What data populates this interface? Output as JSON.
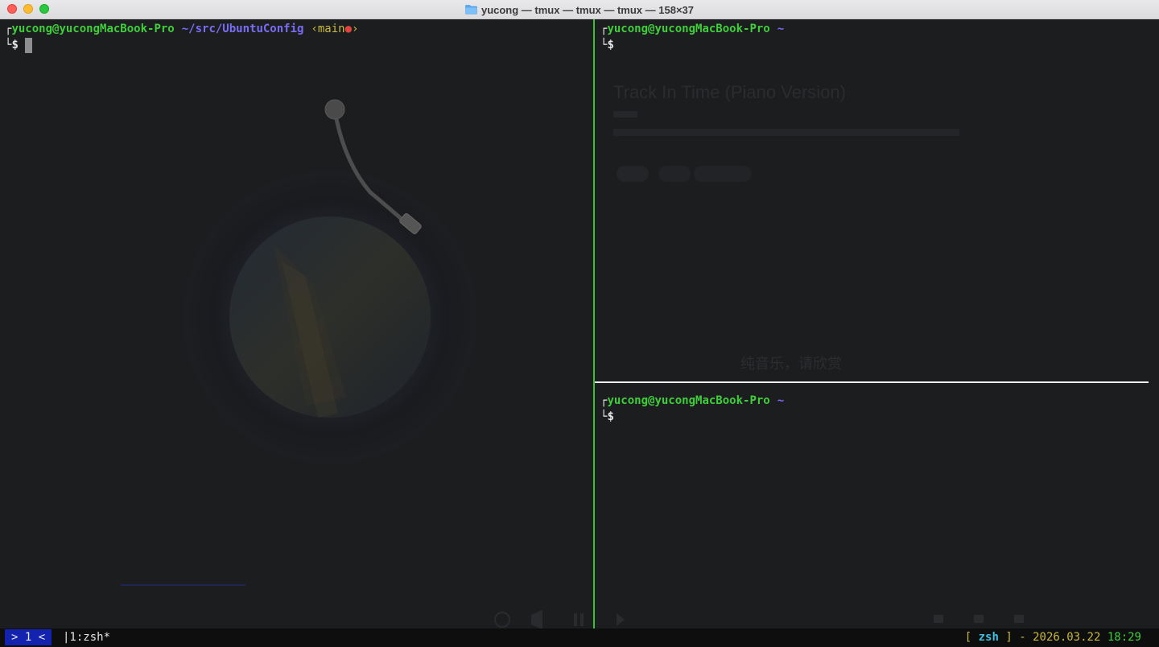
{
  "window": {
    "title": "yucong — tmux — tmux — tmux — 158×37"
  },
  "panes": {
    "left": {
      "user_host": "yucong@yucongMacBook-Pro",
      "path": "~/src/UbuntuConfig",
      "branch_open": "‹main",
      "branch_dot": "●",
      "branch_close": "›",
      "prompt": "$"
    },
    "right_top": {
      "user_host": "yucong@yucongMacBook-Pro",
      "path": "~",
      "prompt": "$"
    },
    "right_bottom": {
      "user_host": "yucong@yucongMacBook-Pro",
      "path": "~",
      "prompt": "$"
    }
  },
  "background_app": {
    "song_title": "Track In Time (Piano Version)",
    "lyrics_notice": "纯音乐，请欣赏"
  },
  "statusbar": {
    "window_indicator": "> 1 <",
    "window_list": "|1:zsh*",
    "bracket_open": "[",
    "shell": "zsh",
    "bracket_close": "]",
    "separator": "-",
    "date": "2026.03.22",
    "time": "18:29"
  },
  "colors": {
    "user": "#3fcf3a",
    "path": "#7b6cf6",
    "branch": "#c9b93b",
    "pane_border_active": "#3bc230",
    "status_window_bg": "#1422b0"
  }
}
